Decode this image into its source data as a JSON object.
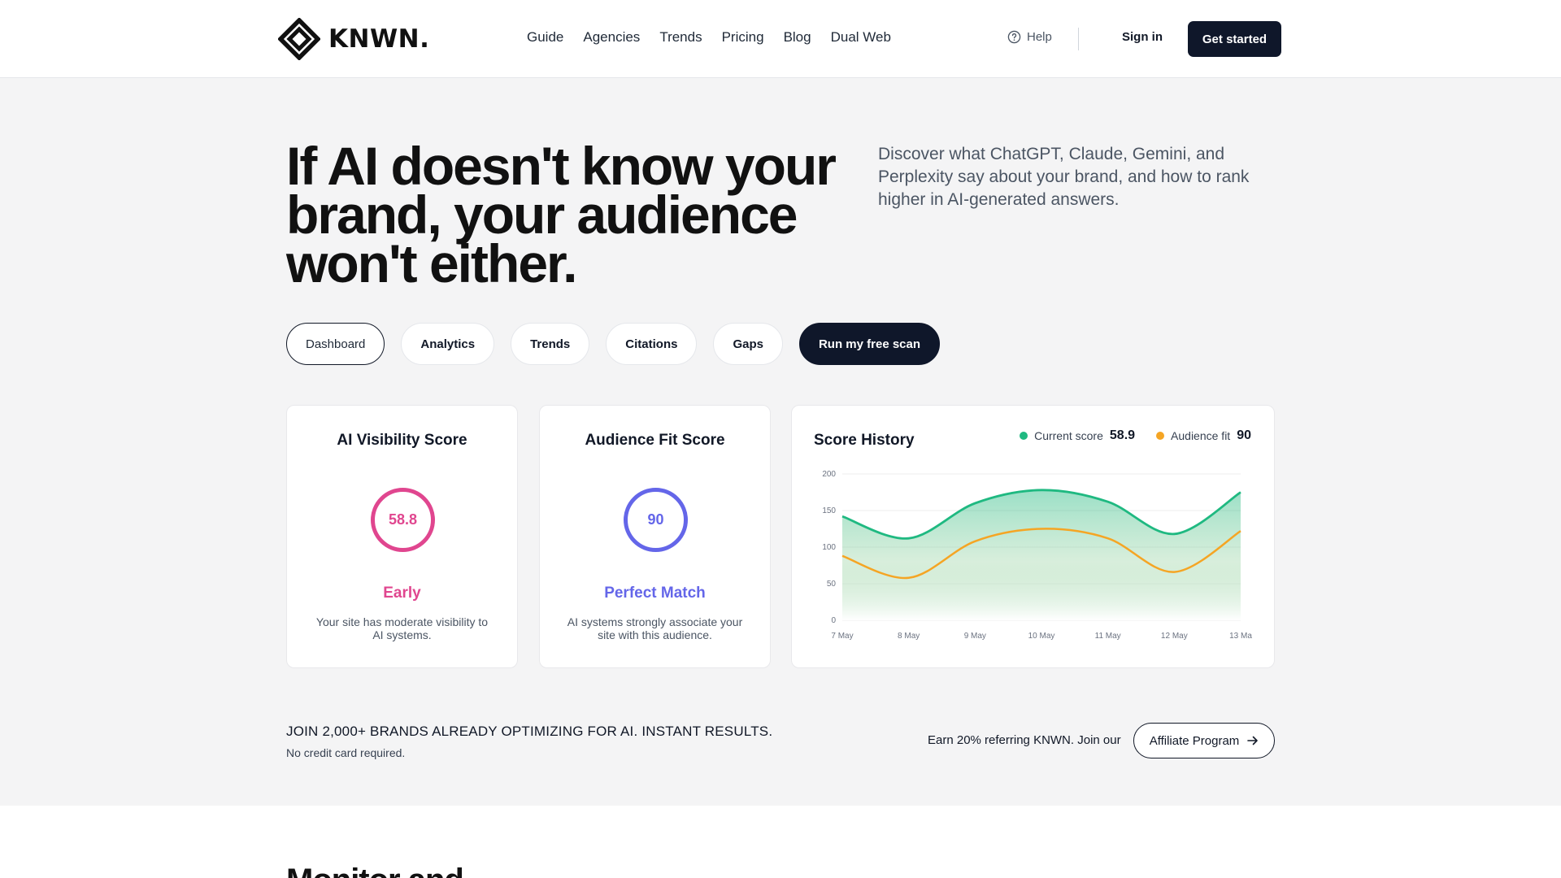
{
  "brand": {
    "name": "KNWN."
  },
  "nav": [
    "Guide",
    "Agencies",
    "Trends",
    "Pricing",
    "Blog",
    "Dual Web"
  ],
  "header": {
    "help": "Help",
    "signin": "Sign in",
    "cta": "Get started"
  },
  "hero": {
    "title": "If AI doesn't know your brand, your audience won't either.",
    "subtitle": "Discover what ChatGPT, Claude, Gemini, and Perplexity say about your brand, and how to rank higher in AI-generated answers."
  },
  "tabs": [
    "Dashboard",
    "Analytics",
    "Trends",
    "Citations",
    "Gaps"
  ],
  "scan_button": "Run my free scan",
  "cards": {
    "visibility": {
      "title": "AI Visibility Score",
      "value": "58.8",
      "status": "Early",
      "desc": "Your site has moderate visibility to AI systems.",
      "color": "#e0468f"
    },
    "audience": {
      "title": "Audience Fit Score",
      "value": "90",
      "status": "Perfect Match",
      "desc": "AI systems strongly associate your site with this audience.",
      "color": "#6466e9"
    }
  },
  "history": {
    "title": "Score History",
    "legend": [
      {
        "label": "Current score",
        "value": "58.9",
        "color": "#1fb981"
      },
      {
        "label": "Audience fit",
        "value": "90",
        "color": "#f5a524"
      }
    ]
  },
  "chart_data": {
    "type": "line",
    "x": [
      "7 May",
      "8 May",
      "9 May",
      "10 May",
      "11 May",
      "12 May",
      "13 Ma"
    ],
    "ylim": [
      0,
      200
    ],
    "yticks": [
      0,
      50,
      100,
      150,
      200
    ],
    "grid": true,
    "series": [
      {
        "name": "Current score",
        "values": [
          142,
          112,
          160,
          178,
          162,
          118,
          175
        ]
      },
      {
        "name": "Audience fit",
        "values": [
          88,
          58,
          108,
          125,
          112,
          66,
          122
        ]
      }
    ]
  },
  "join": {
    "title": "JOIN 2,000+ BRANDS ALREADY OPTIMIZING FOR AI. INSTANT RESULTS.",
    "sub": "No credit card required.",
    "earn": "Earn 20% referring KNWN. Join our",
    "affiliate": "Affiliate Program"
  },
  "bottom": {
    "heading": "Monitor and"
  }
}
